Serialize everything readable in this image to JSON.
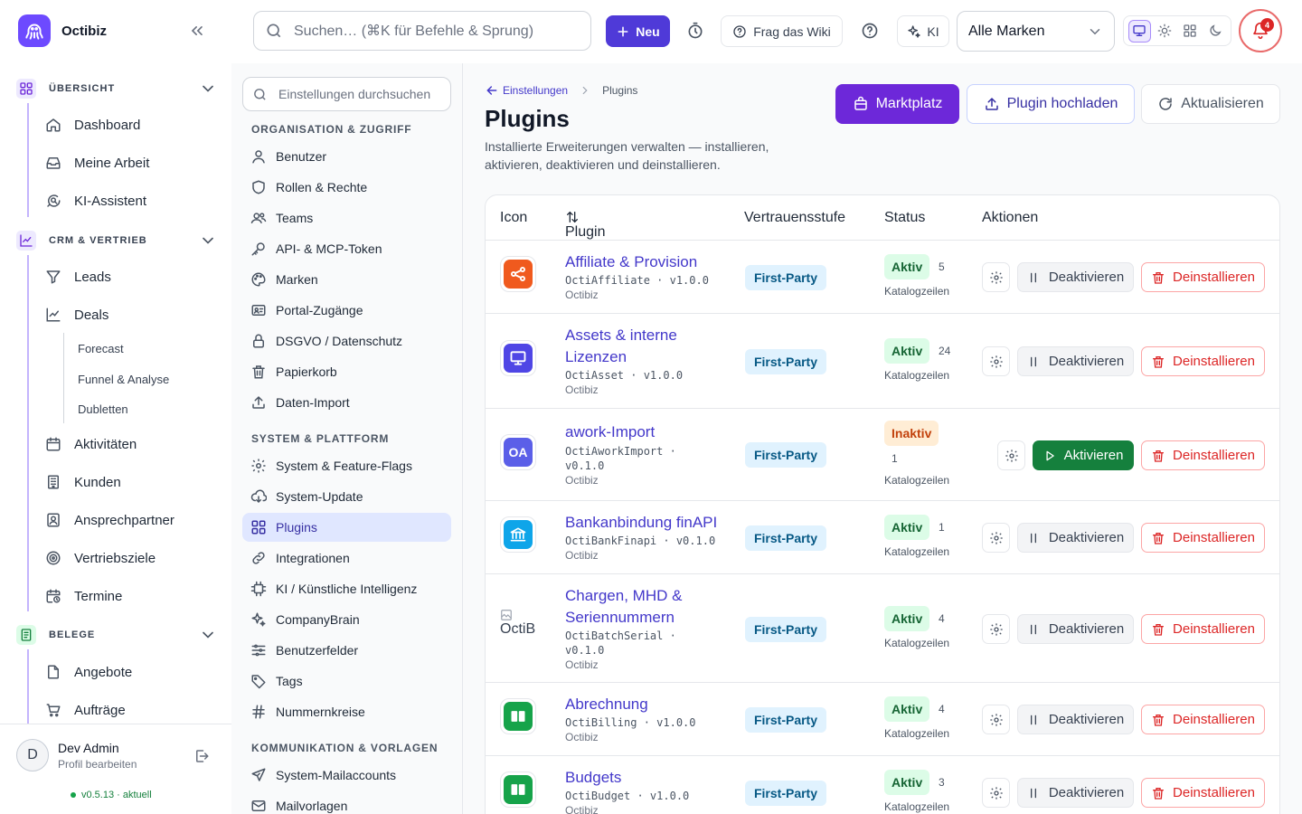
{
  "app": {
    "name": "Octibiz"
  },
  "topbar": {
    "search_placeholder": "Suchen… (⌘K für Befehle & Sprung)",
    "new_label": "Neu",
    "wiki_label": "Frag das Wiki",
    "ki_label": "KI",
    "brand_select": "Alle Marken",
    "notification_count": "4"
  },
  "sidebar": {
    "sections": [
      {
        "label": "ÜBERSICHT",
        "items": [
          "Dashboard",
          "Meine Arbeit",
          "KI-Assistent"
        ]
      },
      {
        "label": "CRM & VERTRIEB",
        "items": [
          "Leads",
          "Deals",
          "Aktivitäten",
          "Kunden",
          "Ansprechpartner",
          "Vertriebsziele",
          "Termine"
        ],
        "deal_subitems": [
          "Forecast",
          "Funnel & Analyse",
          "Dubletten"
        ]
      },
      {
        "label": "BELEGE",
        "items": [
          "Angebote",
          "Aufträge"
        ]
      }
    ],
    "user": {
      "name": "Dev Admin",
      "sub": "Profil bearbeiten",
      "initial": "D"
    },
    "version": "v0.5.13 · aktuell"
  },
  "settings": {
    "search_placeholder": "Einstellungen durchsuchen",
    "groups": [
      {
        "label": "ORGANISATION & ZUGRIFF",
        "items": [
          "Benutzer",
          "Rollen & Rechte",
          "Teams",
          "API- & MCP-Token",
          "Marken",
          "Portal-Zugänge",
          "DSGVO / Datenschutz",
          "Papierkorb",
          "Daten-Import"
        ]
      },
      {
        "label": "SYSTEM & PLATTFORM",
        "items": [
          "System & Feature-Flags",
          "System-Update",
          "Plugins",
          "Integrationen",
          "KI / Künstliche Intelligenz",
          "CompanyBrain",
          "Benutzerfelder",
          "Tags",
          "Nummernkreise"
        ]
      },
      {
        "label": "KOMMUNIKATION & VORLAGEN",
        "items": [
          "System-Mailaccounts",
          "Mailvorlagen"
        ]
      }
    ]
  },
  "main": {
    "breadcrumb": {
      "back": "Einstellungen",
      "current": "Plugins"
    },
    "title": "Plugins",
    "description": "Installierte Erweiterungen verwalten — installieren, aktivieren, deaktivieren und deinstallieren.",
    "buttons": {
      "market": "Marktplatz",
      "upload": "Plugin hochladen",
      "refresh": "Aktualisieren"
    },
    "columns": [
      "Icon",
      "Plugin",
      "Vertrauensstufe",
      "Status",
      "Aktionen"
    ],
    "actions": {
      "deactivate": "Deaktivieren",
      "activate": "Aktivieren",
      "uninstall": "Deinstallieren"
    },
    "status_suffix": "Katalogzeilen",
    "plugins": [
      {
        "name": "Affiliate & Provision",
        "meta": "OctiAffiliate · v1.0.0",
        "vendor": "Octibiz",
        "trust": "First-Party",
        "status": "Aktiv",
        "count": "5",
        "icon": "share-icon",
        "color": "#f05a1e"
      },
      {
        "name": "Assets & interne Lizenzen",
        "meta": "OctiAsset · v1.0.0",
        "vendor": "Octibiz",
        "trust": "First-Party",
        "status": "Aktiv",
        "count": "24",
        "icon": "monitor-icon",
        "color": "#4f46e5"
      },
      {
        "name": "awork-Import",
        "meta": "OctiAworkImport · v0.1.0",
        "vendor": "Octibiz",
        "trust": "First-Party",
        "status": "Inaktiv",
        "count": "1",
        "icon": "OA",
        "color": "#5b5fe8"
      },
      {
        "name": "Bankanbindung finAPI",
        "meta": "OctiBankFinapi · v0.1.0",
        "vendor": "Octibiz",
        "trust": "First-Party",
        "status": "Aktiv",
        "count": "1",
        "icon": "bank-icon",
        "color": "#0ea5e9"
      },
      {
        "name": "Chargen, MHD & Seriennummern",
        "meta": "OctiBatchSerial · v0.1.0",
        "vendor": "Octibiz",
        "trust": "First-Party",
        "status": "Aktiv",
        "count": "4",
        "icon": "OctiB",
        "color": "#ffffff"
      },
      {
        "name": "Abrechnung",
        "meta": "OctiBilling · v1.0.0",
        "vendor": "Octibiz",
        "trust": "First-Party",
        "status": "Aktiv",
        "count": "4",
        "icon": "book-icon",
        "color": "#16a34a"
      },
      {
        "name": "Budgets",
        "meta": "OctiBudget · v1.0.0",
        "vendor": "Octibiz",
        "trust": "First-Party",
        "status": "Aktiv",
        "count": "3",
        "icon": "book-icon",
        "color": "#16a34a"
      }
    ]
  }
}
